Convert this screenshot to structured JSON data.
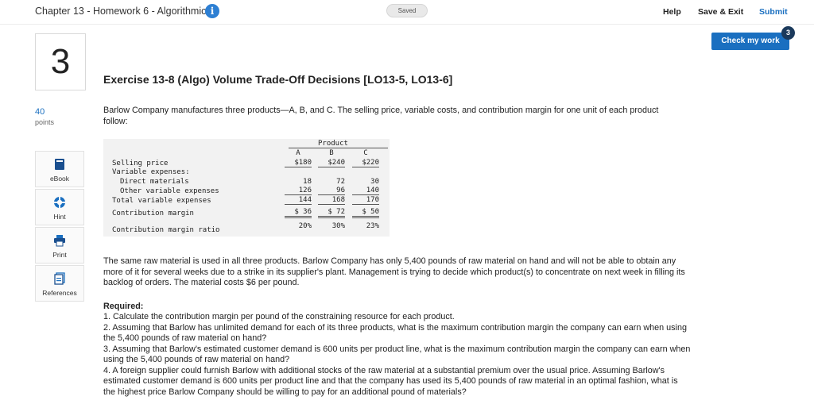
{
  "header": {
    "assignment_title": "Chapter 13 - Homework 6 - Algorithmic",
    "info_icon": "info-icon",
    "saved_status": "Saved",
    "help_label": "Help",
    "save_exit_label": "Save & Exit",
    "submit_label": "Submit"
  },
  "check_work": {
    "label": "Check my work",
    "badge_count": "3"
  },
  "question": {
    "number": "3",
    "points_value": "40",
    "points_label": "points"
  },
  "tools": [
    {
      "label": "eBook",
      "icon": "book-icon"
    },
    {
      "label": "Hint",
      "icon": "lifebuoy-icon"
    },
    {
      "label": "Print",
      "icon": "printer-icon"
    },
    {
      "label": "References",
      "icon": "document-icon"
    }
  ],
  "exercise": {
    "title": "Exercise 13-8 (Algo) Volume Trade-Off Decisions [LO13-5, LO13-6]",
    "intro": "Barlow Company manufactures three products—A, B, and C. The selling price, variable costs, and contribution margin for one unit of each product follow:",
    "table": {
      "group_header": "Product",
      "columns": [
        "A",
        "B",
        "C"
      ],
      "rows": [
        {
          "label": "Selling price",
          "values": [
            "$180",
            "$240",
            "$220"
          ]
        },
        {
          "label": "Variable expenses:",
          "values": [
            "",
            "",
            ""
          ]
        },
        {
          "label": "Direct materials",
          "values": [
            "18",
            "72",
            "30"
          ]
        },
        {
          "label": "Other variable expenses",
          "values": [
            "126",
            "96",
            "140"
          ]
        },
        {
          "label": "Total variable expenses",
          "values": [
            "144",
            "168",
            "170"
          ]
        },
        {
          "label": "Contribution margin",
          "values": [
            "$ 36",
            "$ 72",
            "$ 50"
          ]
        },
        {
          "label": "Contribution margin ratio",
          "values": [
            "20%",
            "30%",
            "23%"
          ]
        }
      ]
    },
    "paragraph2": "The same raw material is used in all three products. Barlow Company has only 5,400 pounds of raw material on hand and will not be able to obtain any more of it for several weeks due to a strike in its supplier's plant. Management is trying to decide which product(s) to concentrate on next week in filling its backlog of orders. The material costs $6 per pound.",
    "required_heading": "Required:",
    "required_items": [
      "1. Calculate the contribution margin per pound of the constraining resource for each product.",
      "2. Assuming that Barlow has unlimited demand for each of its three products, what is the maximum contribution margin the company can earn when using the 5,400 pounds of raw material on hand?",
      "3. Assuming that Barlow's estimated customer demand is 600 units per product line, what is the maximum contribution margin the company can earn when using the 5,400 pounds of raw material on hand?",
      "4. A foreign supplier could furnish Barlow with additional stocks of the raw material at a substantial premium over the usual price. Assuming Barlow's estimated customer demand is 600 units per product line and that the company has used its 5,400 pounds of raw material in an optimal fashion, what is the highest price Barlow Company should be willing to pay for an additional pound of materials?"
    ]
  },
  "colors": {
    "accent": "#1a6fc0",
    "badge": "#1b3a5c",
    "table_bg": "#f2f2f2"
  }
}
